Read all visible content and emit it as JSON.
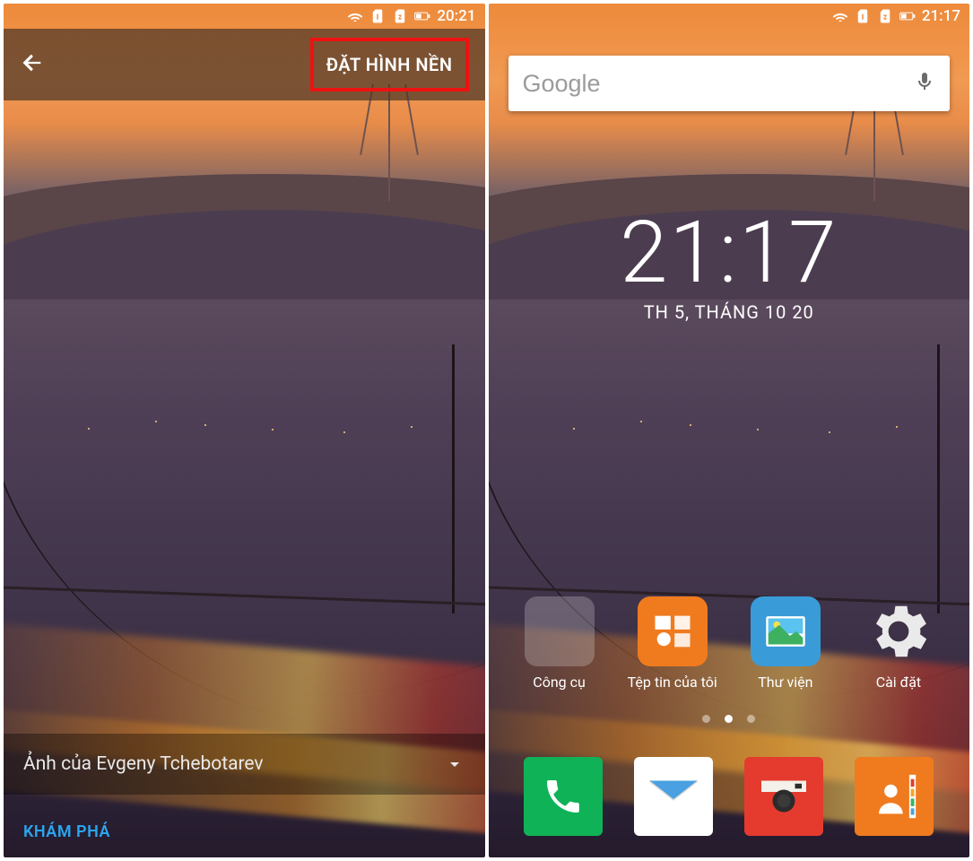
{
  "screenA": {
    "status_time": "20:21",
    "set_wallpaper_label": "ĐẶT HÌNH NỀN",
    "credit_text": "Ảnh của Evgeny Tchebotarev",
    "explore_label": "KHÁM PHÁ"
  },
  "screenB": {
    "status_time": "21:17",
    "search_placeholder": "Google",
    "clock_time": "21:17",
    "clock_date": "TH 5, THÁNG 10 20",
    "apps": [
      {
        "label": "Công cụ"
      },
      {
        "label": "Tệp tin của tôi"
      },
      {
        "label": "Thư viện"
      },
      {
        "label": "Cài đặt"
      }
    ]
  }
}
